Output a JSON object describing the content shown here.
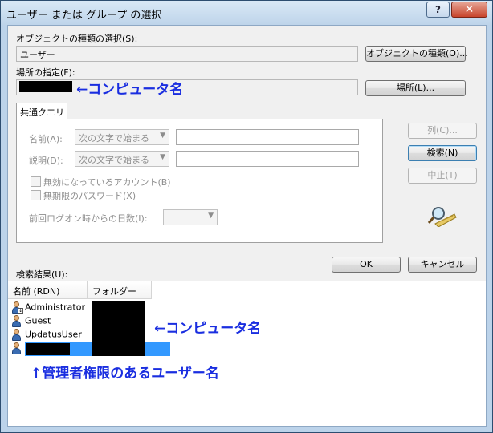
{
  "window": {
    "title": "ユーザー または グループ の選択",
    "help_label": "?",
    "close_label": "✕"
  },
  "object_type": {
    "label": "オブジェクトの種類の選択(S):",
    "value": "ユーザー",
    "button_label": "オブジェクトの種類(O)..."
  },
  "location": {
    "label": "場所の指定(F):",
    "annotation": "←コンピュータ名",
    "button_label": "場所(L)..."
  },
  "query": {
    "tab_label": "共通クエリ",
    "name_label": "名前(A):",
    "name_mode": "次の文字で始まる",
    "desc_label": "説明(D):",
    "desc_mode": "次の文字で始まる",
    "disabled_accounts_label": "無効になっているアカウント(B)",
    "nonexpiring_pw_label": "無期限のパスワード(X)",
    "days_since_logon_label": "前回ログオン時からの日数(I):"
  },
  "side_buttons": {
    "columns": "列(C)...",
    "search": "検索(N)",
    "stop": "中止(T)"
  },
  "results": {
    "label": "検索結果(U):",
    "ok": "OK",
    "cancel": "キャンセル",
    "columns": [
      "名前 (RDN)",
      "フォルダー"
    ],
    "rows": [
      {
        "name": "Administrator"
      },
      {
        "name": "Guest"
      },
      {
        "name": "UpdatusUser"
      },
      {
        "name": ""
      }
    ],
    "annotation_computer": "←コンピュータ名",
    "annotation_admin": "↑管理者権限のあるユーザー名"
  },
  "colors": {
    "annotation": "#1a2ee0",
    "selection": "#3399ff"
  }
}
